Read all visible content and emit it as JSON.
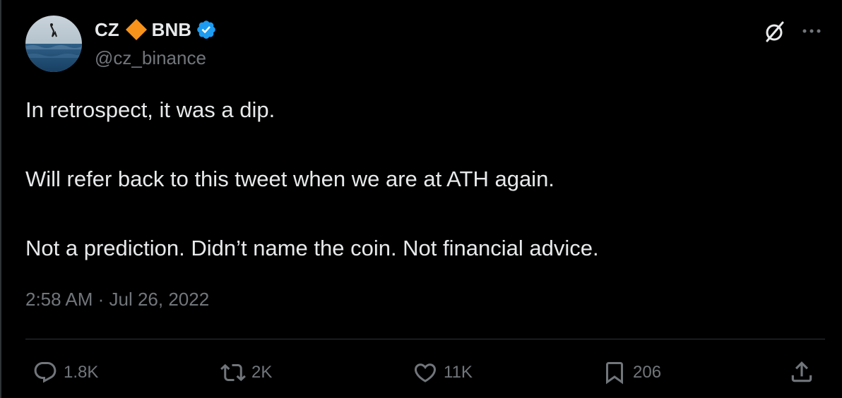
{
  "author": {
    "name_part1": "CZ",
    "badge_icon": "orange-diamond-icon",
    "name_part2": "BNB",
    "verified_icon": "verified-badge-icon",
    "handle": "@cz_binance"
  },
  "header_actions": {
    "grok_icon": "grok-icon",
    "more_icon": "more-icon"
  },
  "tweet": {
    "lines": [
      "In retrospect, it was a dip.",
      "Will refer back to this tweet when we are at ATH again.",
      "Not a prediction. Didn’t name the coin. Not financial advice."
    ],
    "timestamp": "2:58 AM · Jul 26, 2022"
  },
  "actions": {
    "replies": "1.8K",
    "reposts": "2K",
    "likes": "11K",
    "bookmarks": "206"
  },
  "colors": {
    "background": "#000000",
    "text": "#e7e9ea",
    "muted": "#71767b",
    "divider": "#2f3336",
    "verified": "#1d9bf0",
    "diamond": "#f7931a"
  }
}
